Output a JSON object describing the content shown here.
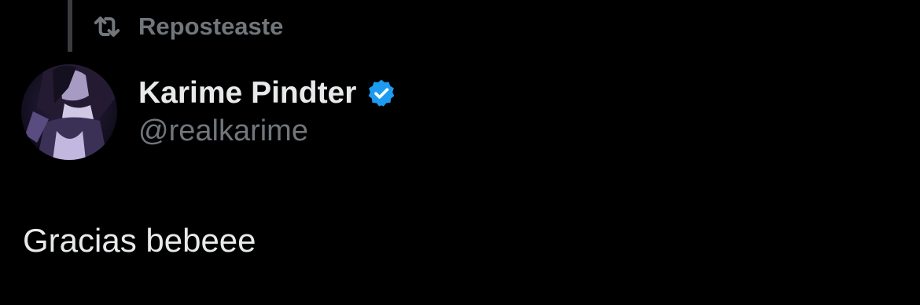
{
  "repost": {
    "icon": "repost-icon",
    "label": "Reposteaste"
  },
  "author": {
    "display_name": "Karime Pindter",
    "handle": "@realkarime",
    "verified_icon": "verified-badge-icon",
    "verified_color": "#1d9bf0"
  },
  "tweet": {
    "text": "Gracias bebeee"
  },
  "colors": {
    "background": "#000000",
    "primary_text": "#e7e9ea",
    "secondary_text": "#71767b",
    "thread_line": "#3a3c40"
  }
}
